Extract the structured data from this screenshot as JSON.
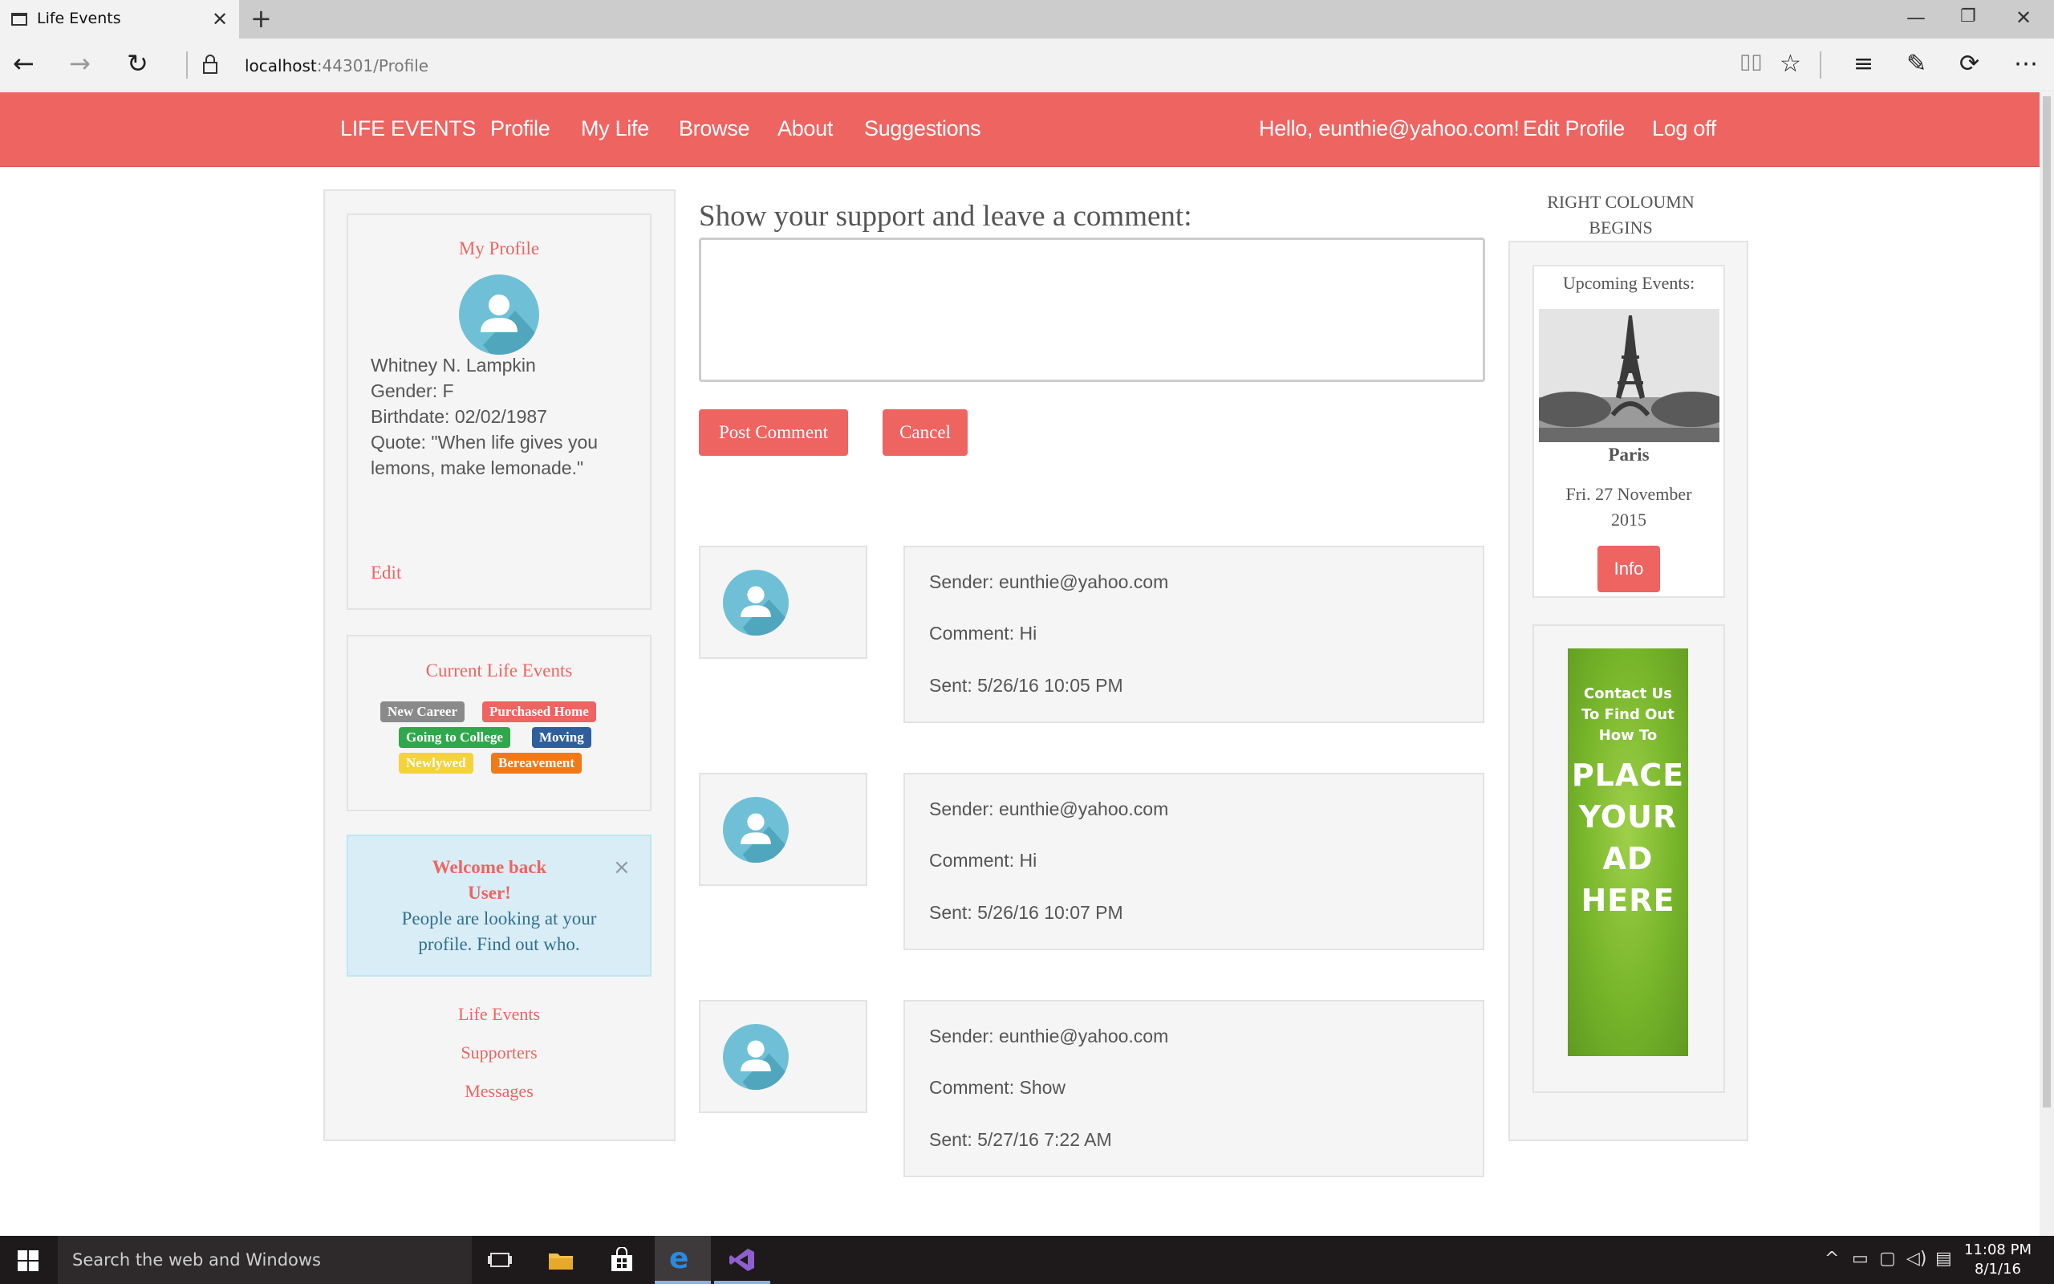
{
  "browser": {
    "tab_title": "Life Events",
    "url_host": "localhost",
    "url_rest": ":44301/Profile"
  },
  "navbar": {
    "brand": "LIFE EVENTS",
    "links": [
      "Profile",
      "My Life",
      "Browse",
      "About",
      "Suggestions"
    ],
    "greeting": "Hello, eunthie@yahoo.com!",
    "edit_profile": "Edit Profile",
    "log_off": "Log off"
  },
  "profile": {
    "title": "My Profile",
    "name": "Whitney  N.  Lampkin",
    "gender": "Gender: F",
    "birthdate": "Birthdate: 02/02/1987",
    "quote_line1": "Quote: \"When life gives you",
    "quote_line2": "lemons, make lemonade.\"",
    "edit": "Edit"
  },
  "life_events": {
    "title": "Current Life Events",
    "tags": [
      {
        "label": "New Career",
        "color": "#8a8a8a"
      },
      {
        "label": "Purchased Home",
        "color": "#ee6461"
      },
      {
        "label": "Going to College",
        "color": "#2ea84a"
      },
      {
        "label": "Moving",
        "color": "#2f5f9a"
      },
      {
        "label": "Newlywed",
        "color": "#f4d23a"
      },
      {
        "label": "Bereavement",
        "color": "#f07a1a"
      }
    ]
  },
  "alert": {
    "title_line1": "Welcome back",
    "title_line2": "User!",
    "body_line1": "People are looking at your",
    "body_line2": "profile. Find out who."
  },
  "side_links": [
    "Life Events",
    "Supporters",
    "Messages"
  ],
  "comment_form": {
    "heading": "Show your support and leave a comment:",
    "post_label": "Post Comment",
    "cancel_label": "Cancel"
  },
  "comments": [
    {
      "sender": "Sender: eunthie@yahoo.com",
      "comment": "Comment: Hi",
      "sent": "Sent: 5/26/16 10:05 PM"
    },
    {
      "sender": "Sender: eunthie@yahoo.com",
      "comment": "Comment: Hi",
      "sent": "Sent: 5/26/16 10:07 PM"
    },
    {
      "sender": "Sender: eunthie@yahoo.com",
      "comment": "Comment: Show",
      "sent": "Sent: 5/27/16 7:22 AM"
    }
  ],
  "right_column": {
    "title_line1": "RIGHT COLOUMN",
    "title_line2": "BEGINS",
    "upcoming_title": "Upcoming Events:",
    "event_city": "Paris",
    "event_date_line1": "Fri. 27 November",
    "event_date_line2": "2015",
    "info_label": "Info",
    "ad_small": [
      "Contact Us",
      "To Find Out",
      "How To"
    ],
    "ad_big": [
      "PLACE",
      "YOUR",
      "AD",
      "HERE"
    ]
  },
  "taskbar": {
    "search_placeholder": "Search the web and Windows",
    "time": "11:08 PM",
    "date": "8/1/16"
  },
  "colors": {
    "accent": "#ee6461",
    "alert_bg": "#d9edf7",
    "avatar": "#6fc0d6"
  }
}
